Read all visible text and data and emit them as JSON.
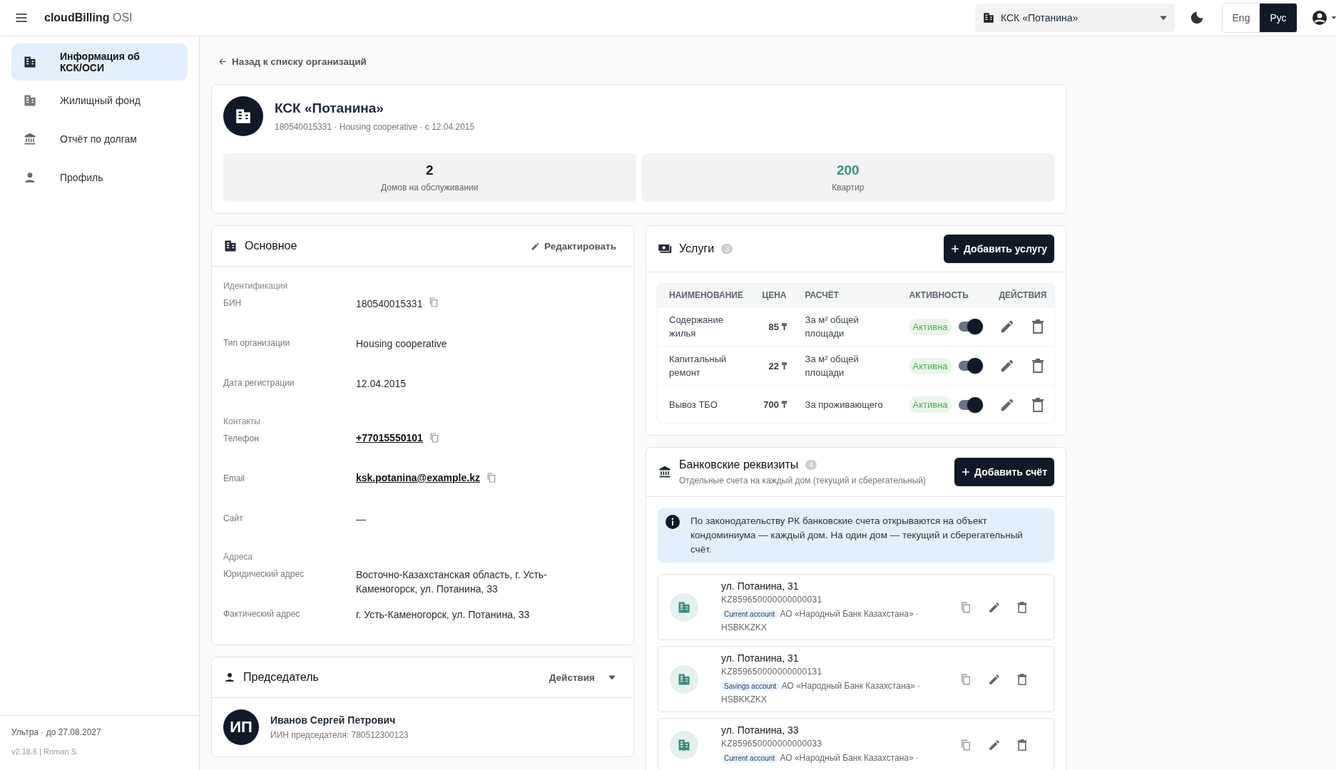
{
  "app": {
    "brand": "cloudBilling",
    "brand_suffix": "OSI"
  },
  "org_selector": {
    "value": "КСК «Потанина»"
  },
  "languages": [
    {
      "label": "Eng",
      "selected": false
    },
    {
      "label": "Рус",
      "selected": true
    }
  ],
  "sidebar": {
    "items": [
      {
        "label": "Информация об КСК/ОСИ",
        "kind": "organization",
        "selected": true
      },
      {
        "label": "Жилищный фонд",
        "kind": "housing",
        "selected": false
      },
      {
        "label": "Отчёт по долгам",
        "kind": "debts",
        "selected": false
      },
      {
        "label": "Профиль",
        "kind": "profile",
        "selected": false
      }
    ],
    "plan": "Ультра · до 27.08.2027",
    "version": "v2.18.6 | Roman S."
  },
  "back_link": "Назад к списку организаций",
  "org": {
    "name": "КСК «Потанина»",
    "meta": "180540015331 · Housing cooperative · с 12.04.2015",
    "stats": [
      {
        "value": "2",
        "label": "Домов на обслуживании",
        "color": "#111827"
      },
      {
        "value": "200",
        "label": "Квартир",
        "color": "#3a8f80"
      }
    ]
  },
  "main_info": {
    "title": "Основное",
    "edit": "Редактировать",
    "groups": [
      {
        "heading": "Идентификация",
        "fields": [
          {
            "label": "БИН",
            "value": "180540015331",
            "kind": "copy"
          },
          {
            "label": "Тип организации",
            "value": "Housing cooperative",
            "kind": "text"
          },
          {
            "label": "Дата регистрации",
            "value": "12.04.2015",
            "kind": "text"
          }
        ]
      },
      {
        "heading": "Контакты",
        "fields": [
          {
            "label": "Телефон",
            "value": "+77015550101",
            "kind": "link"
          },
          {
            "label": "Email",
            "value": "ksk.potanina@example.kz",
            "kind": "link"
          },
          {
            "label": "Сайт",
            "value": "—",
            "kind": "text"
          }
        ]
      },
      {
        "heading": "Адреса",
        "fields": [
          {
            "label": "Юридический адрес",
            "value": "Восточно-Казахстанская область, г. Усть-Каменогорск, ул. Потанина, 33",
            "kind": "text"
          },
          {
            "label": "Фактический адрес",
            "value": "г. Усть-Каменогорск, ул. Потанина, 33",
            "kind": "text"
          }
        ]
      }
    ]
  },
  "chairman": {
    "title": "Председатель",
    "actions": "Действия",
    "initials": "ИП",
    "name": "Иванов Сергей Петрович",
    "iin": "ИИН председателя: 780512300123"
  },
  "services": {
    "title": "Услуги",
    "count": "3",
    "add": "Добавить услугу",
    "columns": [
      "НАИМЕНОВАНИЕ",
      "ЦЕНА",
      "РАСЧЁТ",
      "АКТИВНОСТЬ",
      "ДЕЙСТВИЯ"
    ],
    "rows": [
      {
        "name": "Содержание жилья",
        "price": "85 ₸",
        "calc": "За м² общей площади",
        "status": "Активна",
        "on": true
      },
      {
        "name": "Капитальный ремонт",
        "price": "22 ₸",
        "calc": "За м² общей площади",
        "status": "Активна",
        "on": true
      },
      {
        "name": "Вывоз ТБО",
        "price": "700 ₸",
        "calc": "За проживающего",
        "status": "Активна",
        "on": true
      }
    ]
  },
  "bank": {
    "title": "Банковские реквизиты",
    "count": "4",
    "subtitle": "Отдельные счета на каждый дом (текущий и сберегательный)",
    "add": "Добавить счёт",
    "notice": "По законодательству РК банковские счета открываются на объект кондоминиума — каждый дом. На один дом — текущий и сберегательный счёт.",
    "accounts": [
      {
        "address": "ул. Потанина, 31",
        "iban": "KZ859650000000000031",
        "type": "Current account",
        "bank": "АО «Народный Банк Казахстана» ·",
        "bic": "HSBKKZKX"
      },
      {
        "address": "ул. Потанина, 31",
        "iban": "KZ859650000000000131",
        "type": "Savings account",
        "bank": "АО «Народный Банк Казахстана» ·",
        "bic": "HSBKKZKX"
      },
      {
        "address": "ул. Потанина, 33",
        "iban": "KZ859650000000000033",
        "type": "Current account",
        "bank": "АО «Народный Банк Казахстана» ·"
      }
    ]
  }
}
